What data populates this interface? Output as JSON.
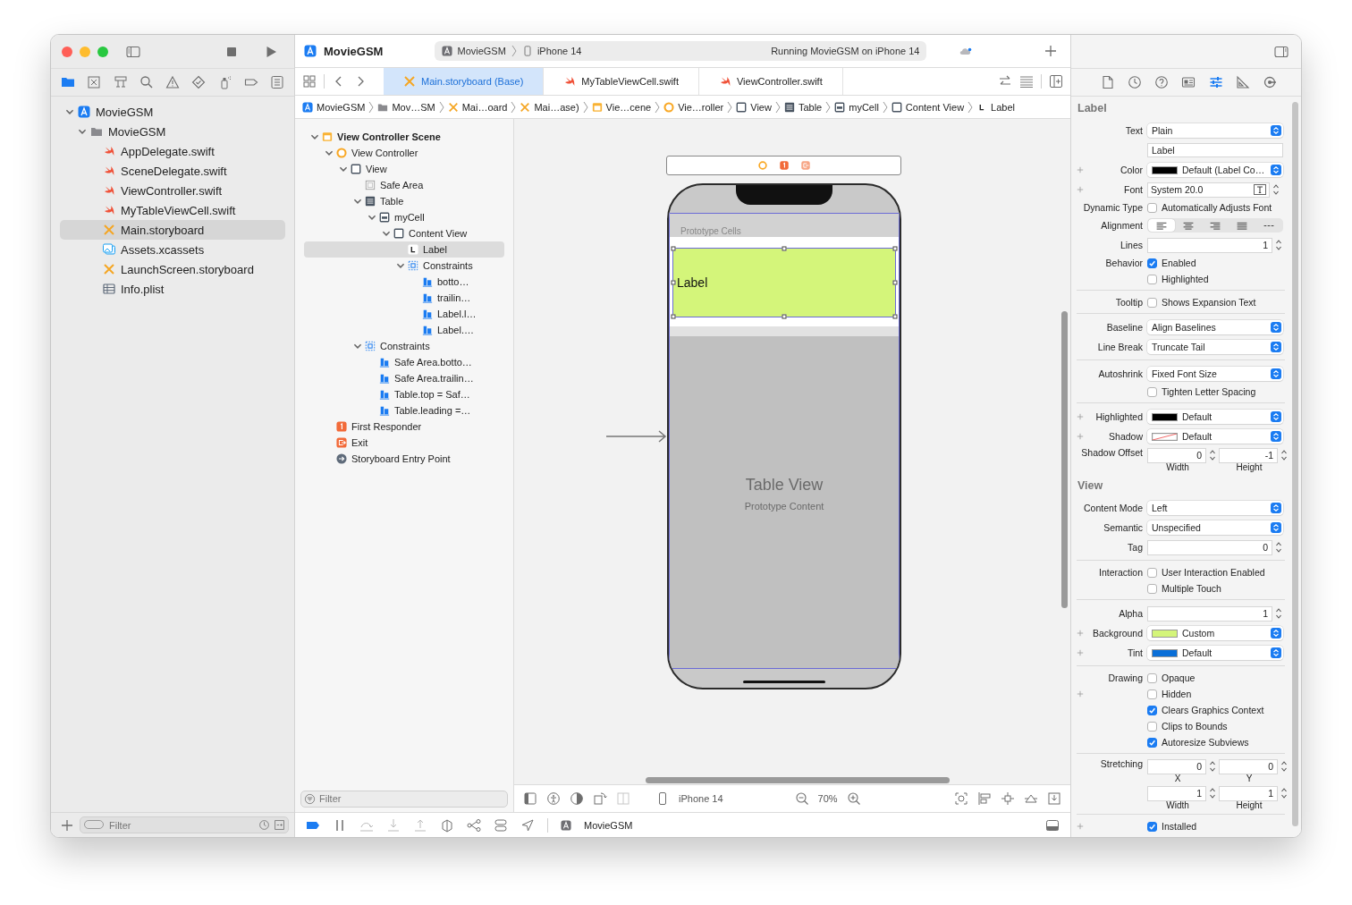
{
  "window": {
    "title": "MovieGSM",
    "scheme": "MovieGSM",
    "destination": "iPhone 14",
    "activity": "Running MovieGSM on iPhone 14"
  },
  "navigator": {
    "tabs": [
      {
        "selected": true
      },
      {
        "selected": false
      },
      {
        "selected": false
      },
      {
        "selected": false
      },
      {
        "selected": false
      },
      {
        "selected": false
      },
      {
        "selected": false
      },
      {
        "selected": false
      },
      {
        "selected": false
      }
    ],
    "tree": [
      {
        "label": "MovieGSM",
        "kind": "project",
        "selected": false,
        "expanded": true,
        "children": [
          {
            "label": "MovieGSM",
            "kind": "folder",
            "selected": false,
            "expanded": true,
            "children": [
              {
                "label": "AppDelegate.swift",
                "kind": "swift",
                "selected": false
              },
              {
                "label": "SceneDelegate.swift",
                "kind": "swift",
                "selected": false
              },
              {
                "label": "ViewController.swift",
                "kind": "swift",
                "selected": false
              },
              {
                "label": "MyTableViewCell.swift",
                "kind": "swift",
                "selected": false
              },
              {
                "label": "Main.storyboard",
                "kind": "storyboard",
                "selected": true
              },
              {
                "label": "Assets.xcassets",
                "kind": "assets",
                "selected": false
              },
              {
                "label": "LaunchScreen.storyboard",
                "kind": "storyboard",
                "selected": false
              },
              {
                "label": "Info.plist",
                "kind": "plist",
                "selected": false
              }
            ]
          }
        ]
      }
    ],
    "filter": {
      "placeholder": "Filter"
    }
  },
  "editor": {
    "tabs": [
      {
        "label": "Main.storyboard (Base)",
        "kind": "storyboard",
        "selected": true
      },
      {
        "label": "MyTableViewCell.swift",
        "kind": "swift",
        "selected": false
      },
      {
        "label": "ViewController.swift",
        "kind": "swift",
        "selected": false
      }
    ],
    "jump_bar": [
      {
        "label": "MovieGSM",
        "kind": "project"
      },
      {
        "label": "Mov…SM",
        "kind": "folder"
      },
      {
        "label": "Mai…oard",
        "kind": "storyboard"
      },
      {
        "label": "Mai…ase)",
        "kind": "storyboard"
      },
      {
        "label": "Vie…cene",
        "kind": "scene"
      },
      {
        "label": "Vie…roller",
        "kind": "controller"
      },
      {
        "label": "View",
        "kind": "view"
      },
      {
        "label": "Table",
        "kind": "table"
      },
      {
        "label": "myCell",
        "kind": "cell"
      },
      {
        "label": "Content View",
        "kind": "view"
      },
      {
        "label": "Label",
        "kind": "label"
      }
    ]
  },
  "outline": {
    "tree": [
      {
        "label": "View Controller Scene",
        "kind": "scene",
        "selected": false,
        "expanded": true,
        "children": [
          {
            "label": "View Controller",
            "kind": "controller",
            "selected": false,
            "expanded": true,
            "children": [
              {
                "label": "View",
                "kind": "view",
                "selected": false,
                "expanded": true,
                "children": [
                  {
                    "label": "Safe Area",
                    "kind": "safe-area",
                    "selected": false
                  },
                  {
                    "label": "Table",
                    "kind": "table",
                    "selected": false,
                    "expanded": true,
                    "children": [
                      {
                        "label": "myCell",
                        "kind": "cell",
                        "selected": false,
                        "expanded": true,
                        "children": [
                          {
                            "label": "Content View",
                            "kind": "view",
                            "selected": false,
                            "expanded": true,
                            "children": [
                              {
                                "label": "Label",
                                "kind": "label",
                                "selected": true
                              },
                              {
                                "label": "Constraints",
                                "kind": "constraints",
                                "selected": false,
                                "expanded": true,
                                "children": [
                                  {
                                    "label": "botto…",
                                    "kind": "constraint",
                                    "selected": false
                                  },
                                  {
                                    "label": "trailin…",
                                    "kind": "constraint",
                                    "selected": false
                                  },
                                  {
                                    "label": "Label.l…",
                                    "kind": "constraint",
                                    "selected": false
                                  },
                                  {
                                    "label": "Label.…",
                                    "kind": "constraint",
                                    "selected": false
                                  }
                                ]
                              }
                            ]
                          }
                        ]
                      }
                    ]
                  },
                  {
                    "label": "Constraints",
                    "kind": "constraints",
                    "selected": false,
                    "expanded": true,
                    "children": [
                      {
                        "label": "Safe Area.botto…",
                        "kind": "constraint",
                        "selected": false
                      },
                      {
                        "label": "Safe Area.trailin…",
                        "kind": "constraint",
                        "selected": false
                      },
                      {
                        "label": "Table.top = Saf…",
                        "kind": "constraint",
                        "selected": false
                      },
                      {
                        "label": "Table.leading =…",
                        "kind": "constraint",
                        "selected": false
                      }
                    ]
                  }
                ]
              }
            ]
          },
          {
            "label": "First Responder",
            "kind": "responder",
            "selected": false
          },
          {
            "label": "Exit",
            "kind": "exit",
            "selected": false
          },
          {
            "label": "Storyboard Entry Point",
            "kind": "entry",
            "selected": false
          }
        ]
      }
    ],
    "filter": {
      "placeholder": "Filter"
    }
  },
  "canvas": {
    "section_header": "Prototype Cells",
    "label_text": "Label",
    "table_title": "Table View",
    "table_subtitle": "Prototype Content",
    "device": "iPhone 14",
    "zoom": "70%"
  },
  "debug_bar": {
    "breakpoints_active": true,
    "target": "MovieGSM"
  },
  "inspector": {
    "tabs": [
      {
        "selected": false
      },
      {
        "selected": false
      },
      {
        "selected": false
      },
      {
        "selected": false
      },
      {
        "selected": true
      },
      {
        "selected": false
      },
      {
        "selected": false
      }
    ],
    "sections": [
      {
        "title": "Label",
        "groups": [
          [
            {
              "kind": "popup",
              "label": "Text",
              "value": "Plain",
              "plus": false
            },
            {
              "kind": "text",
              "value": "Label",
              "plus": false
            },
            {
              "kind": "popup",
              "label": "Color",
              "value": "Default (Label Co…",
              "color": "#000000",
              "plus": true
            },
            {
              "kind": "font",
              "label": "Font",
              "value": "System 20.0",
              "plus": true
            },
            {
              "kind": "checkbox",
              "label": "Dynamic Type",
              "text": "Automatically Adjusts Font",
              "checked": false,
              "plus": false
            },
            {
              "kind": "segmented",
              "label": "Alignment",
              "segments": [
                {
                  "selected": true
                },
                {
                  "selected": false
                },
                {
                  "selected": false
                },
                {
                  "selected": false
                },
                {
                  "selected": false
                }
              ],
              "plus": false
            },
            {
              "kind": "stepper",
              "label": "Lines",
              "value": "1",
              "plus": false
            },
            {
              "kind": "checkbox",
              "label": "Behavior",
              "text": "Enabled",
              "checked": true,
              "plus": false
            },
            {
              "kind": "checkbox",
              "text": "Highlighted",
              "checked": false,
              "plus": false
            }
          ],
          [
            {
              "kind": "checkbox",
              "label": "Tooltip",
              "text": "Shows Expansion Text",
              "checked": false,
              "plus": false
            }
          ],
          [
            {
              "kind": "popup",
              "label": "Baseline",
              "value": "Align Baselines",
              "plus": false
            },
            {
              "kind": "popup",
              "label": "Line Break",
              "value": "Truncate Tail",
              "plus": false
            }
          ],
          [
            {
              "kind": "popup",
              "label": "Autoshrink",
              "value": "Fixed Font Size",
              "plus": false
            },
            {
              "kind": "checkbox",
              "text": "Tighten Letter Spacing",
              "checked": false,
              "plus": false
            }
          ],
          [
            {
              "kind": "popup",
              "label": "Highlighted",
              "value": "Default",
              "color": "#000000",
              "plus": true
            },
            {
              "kind": "popup",
              "label": "Shadow",
              "value": "Default",
              "clear_color": true,
              "plus": true
            },
            {
              "kind": "pair",
              "label": "Shadow Offset",
              "fields": [
                {
                  "value": "0",
                  "caption": "Width"
                },
                {
                  "value": "-1",
                  "caption": "Height"
                }
              ],
              "plus": false
            }
          ]
        ]
      },
      {
        "title": "View",
        "groups": [
          [
            {
              "kind": "popup",
              "label": "Content Mode",
              "value": "Left",
              "plus": false
            },
            {
              "kind": "popup",
              "label": "Semantic",
              "value": "Unspecified",
              "plus": false
            },
            {
              "kind": "stepper",
              "label": "Tag",
              "value": "0",
              "plus": false
            }
          ],
          [
            {
              "kind": "checkbox",
              "label": "Interaction",
              "text": "User Interaction Enabled",
              "checked": false,
              "plus": false
            },
            {
              "kind": "checkbox",
              "text": "Multiple Touch",
              "checked": false,
              "plus": false
            }
          ],
          [
            {
              "kind": "stepper",
              "label": "Alpha",
              "value": "1",
              "plus": false
            },
            {
              "kind": "popup",
              "label": "Background",
              "value": "Custom",
              "color": "#d4f57a",
              "plus": true
            },
            {
              "kind": "popup",
              "label": "Tint",
              "value": "Default",
              "color": "#0a6fd8",
              "plus": true
            }
          ],
          [
            {
              "kind": "checkbox",
              "label": "Drawing",
              "text": "Opaque",
              "checked": false,
              "plus": false
            },
            {
              "kind": "checkbox",
              "text": "Hidden",
              "checked": false,
              "plus": true
            },
            {
              "kind": "checkbox",
              "text": "Clears Graphics Context",
              "checked": true,
              "plus": false
            },
            {
              "kind": "checkbox",
              "text": "Clips to Bounds",
              "checked": false,
              "plus": false
            },
            {
              "kind": "checkbox",
              "text": "Autoresize Subviews",
              "checked": true,
              "plus": false
            }
          ],
          [
            {
              "kind": "pair",
              "label": "Stretching",
              "fields": [
                {
                  "value": "0",
                  "caption": "X"
                },
                {
                  "value": "0",
                  "caption": "Y"
                }
              ],
              "plus": false
            },
            {
              "kind": "pair",
              "fields": [
                {
                  "value": "1",
                  "caption": "Width"
                },
                {
                  "value": "1",
                  "caption": "Height"
                }
              ],
              "plus": false
            }
          ],
          [
            {
              "kind": "checkbox",
              "text": "Installed",
              "checked": true,
              "plus": true
            }
          ]
        ]
      }
    ]
  }
}
